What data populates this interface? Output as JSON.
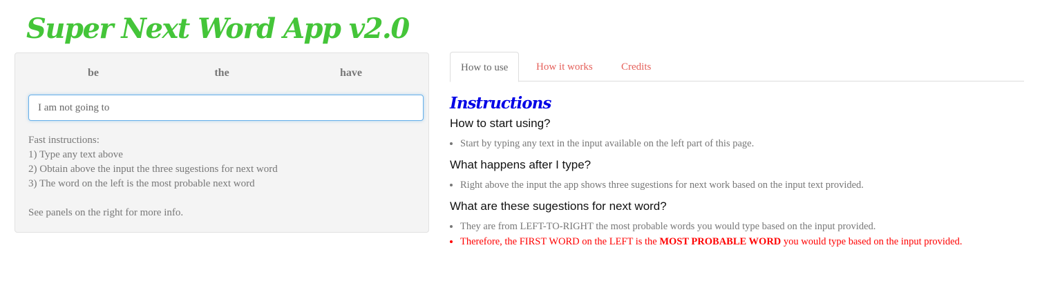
{
  "app_title": "Super Next Word App v2.0",
  "suggestions": [
    "be",
    "the",
    "have"
  ],
  "input": {
    "value": "I am not going to"
  },
  "fast_instructions": {
    "heading": "Fast instructions:",
    "steps": [
      "1) Type any text above",
      "2) Obtain above the input the three sugestions for next word",
      "3) The word on the left is the most probable next word"
    ],
    "footer": "See panels on the right for more info."
  },
  "tabs": [
    {
      "label": "How to use",
      "active": true
    },
    {
      "label": "How it works"
    },
    {
      "label": "Credits"
    }
  ],
  "instructions": {
    "title": "Instructions",
    "sections": [
      {
        "question": "How to start using?",
        "bullets": [
          "Start by typing any text in the input available on the left part of this page."
        ]
      },
      {
        "question": "What happens after I type?",
        "bullets": [
          "Right above the input the app shows three sugestions for next work based on the input text provided."
        ]
      },
      {
        "question": "What are these sugestions for next word?",
        "bullets": [
          "They are from LEFT-TO-RIGHT the most probable words you would type based on the input provided."
        ],
        "highlight": {
          "before": "Therefore, the FIRST WORD on the LEFT is the ",
          "bold": "MOST PROBABLE WORD",
          "after": " you would type based on the input provided."
        }
      }
    ]
  },
  "colors": {
    "title": "#44c539",
    "heading": "#0000e6",
    "tab_link": "#e5605a",
    "highlight": "#ff0000"
  }
}
